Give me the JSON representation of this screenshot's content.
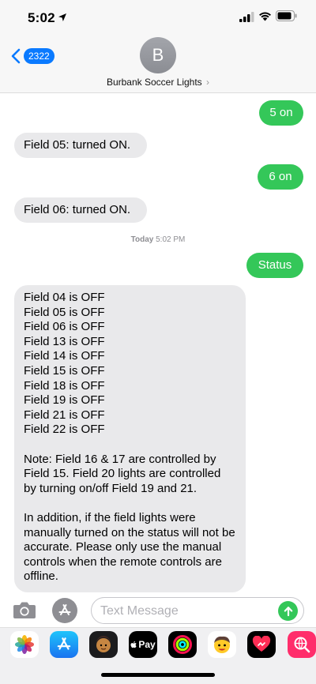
{
  "status_bar": {
    "time": "5:02"
  },
  "header": {
    "back_count": "2322",
    "avatar_initial": "B",
    "contact_name": "Burbank Soccer Lights",
    "contact_chevron": "›"
  },
  "messages": [
    {
      "direction": "outgoing",
      "text": "5 on"
    },
    {
      "direction": "incoming",
      "text": "Field 05: turned ON."
    },
    {
      "direction": "outgoing",
      "text": "6 on"
    },
    {
      "direction": "incoming",
      "text": "Field 06: turned ON."
    },
    {
      "direction": "timestamp",
      "day": "Today",
      "time": "5:02 PM"
    },
    {
      "direction": "outgoing",
      "text": "Status"
    },
    {
      "direction": "incoming",
      "lines": [
        "Field 04 is OFF",
        "Field 05 is OFF",
        "Field 06 is OFF",
        "Field 13 is OFF",
        "Field 14 is OFF",
        "Field 15 is OFF",
        "Field 18 is OFF",
        "Field 19 is OFF",
        "Field 21 is OFF",
        "Field 22 is OFF"
      ],
      "note": "Note: Field 16 & 17 are controlled by Field 15. Field 20 lights are controlled by turning on/off Field 19 and 21.",
      "addition": "In addition, if the field lights were manually turned on the status will not be accurate. Please only use the manual controls when the remote controls are offline."
    }
  ],
  "input_bar": {
    "placeholder": "Text Message",
    "value": ""
  },
  "app_drawer": {
    "apps": [
      "photos-icon",
      "app-store-icon",
      "memoji-icon",
      "apple-pay-icon",
      "activity-icon",
      "animoji-icon",
      "digital-touch-icon",
      "web-search-icon"
    ],
    "apple_pay_label": "Pay"
  },
  "colors": {
    "outgoing_bubble": "#34c759",
    "incoming_bubble": "#e9e9eb",
    "accent_blue": "#0a7aff",
    "header_bg": "#f7f7f7"
  }
}
